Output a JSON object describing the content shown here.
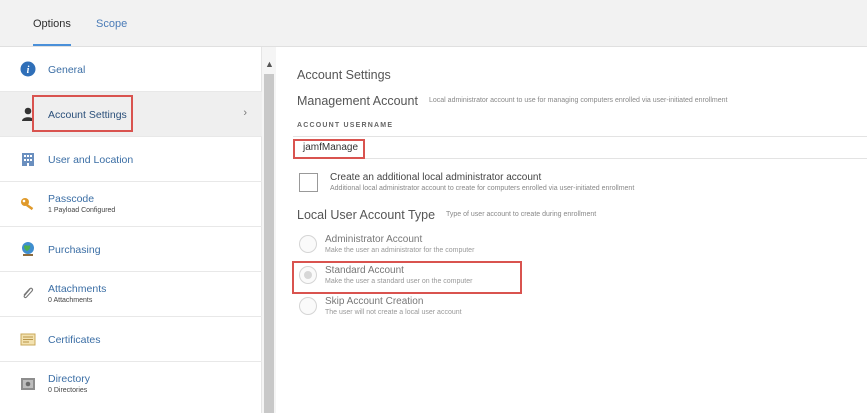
{
  "tabs": {
    "options": "Options",
    "scope": "Scope"
  },
  "sidebar": {
    "items": [
      {
        "label": "General",
        "sub": "",
        "icon": "info-icon"
      },
      {
        "label": "Account Settings",
        "sub": "",
        "icon": "user-icon"
      },
      {
        "label": "User and Location",
        "sub": "",
        "icon": "building-icon"
      },
      {
        "label": "Passcode",
        "sub": "1 Payload Configured",
        "icon": "key-icon"
      },
      {
        "label": "Purchasing",
        "sub": "",
        "icon": "globe-icon"
      },
      {
        "label": "Attachments",
        "sub": "0 Attachments",
        "icon": "paperclip-icon"
      },
      {
        "label": "Certificates",
        "sub": "",
        "icon": "certificate-icon"
      },
      {
        "label": "Directory",
        "sub": "0 Directories",
        "icon": "directory-icon"
      }
    ]
  },
  "main": {
    "title": "Account Settings",
    "management": {
      "heading": "Management Account",
      "description": "Local administrator account to use for managing computers enrolled via user-initiated enrollment",
      "username_label": "ACCOUNT USERNAME",
      "username_value": "jamfManage"
    },
    "additional_admin": {
      "label": "Create an additional local administrator account",
      "description": "Additional local administrator account to create for computers enrolled via user-initiated enrollment"
    },
    "account_type": {
      "heading": "Local User Account Type",
      "description": "Type of user account to create during enrollment",
      "options": [
        {
          "label": "Administrator Account",
          "description": "Make the user an administrator for the computer"
        },
        {
          "label": "Standard Account",
          "description": "Make the user a standard user on the computer"
        },
        {
          "label": "Skip Account Creation",
          "description": "The user will not create a local user account"
        }
      ]
    }
  },
  "colors": {
    "link": "#3b6ea5",
    "highlight": "#d9534f",
    "tab_underline": "#4a90d9"
  }
}
